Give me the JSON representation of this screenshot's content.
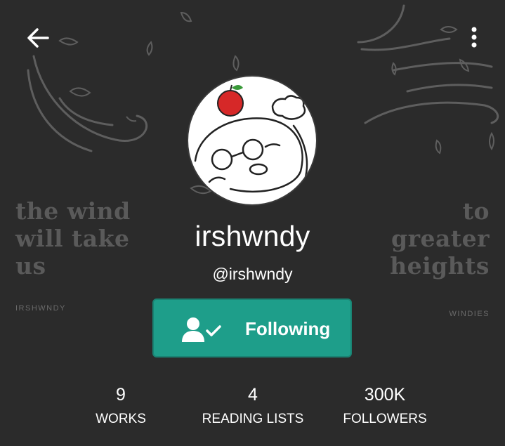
{
  "profile": {
    "username": "irshwndy",
    "handle": "@irshwndy"
  },
  "banner": {
    "quote_left": [
      "the wind",
      "will take",
      "us"
    ],
    "quote_right": [
      "to",
      "greater",
      "heights"
    ],
    "tag_left": "IRSHWNDY",
    "tag_right": "WINDIES"
  },
  "follow_button": {
    "label": "Following",
    "icon": "user-check-icon",
    "color": "#1e9e8a"
  },
  "stats": [
    {
      "value": "9",
      "label": "WORKS"
    },
    {
      "value": "4",
      "label": "READING LISTS"
    },
    {
      "value": "300K",
      "label": "FOLLOWERS"
    }
  ],
  "icons": {
    "back": "arrow-left-icon",
    "menu": "more-vertical-icon"
  },
  "colors": {
    "background": "#2b2b2b",
    "accent": "#1e9e8a",
    "banner_text": "#5a5a5a"
  }
}
